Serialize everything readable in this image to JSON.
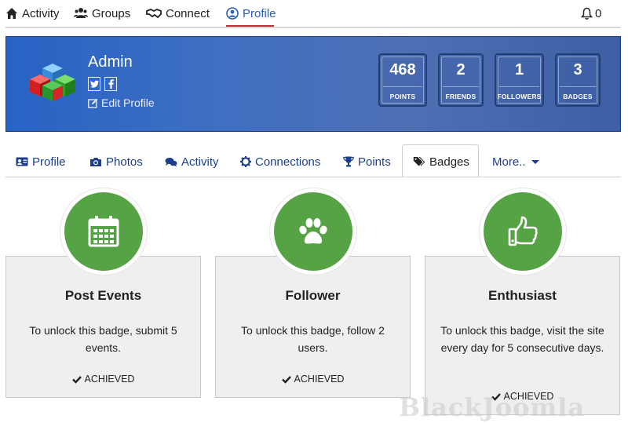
{
  "topnav": {
    "items": [
      {
        "label": "Activity",
        "icon": "home-icon"
      },
      {
        "label": "Groups",
        "icon": "users-icon"
      },
      {
        "label": "Connect",
        "icon": "handshake-icon"
      },
      {
        "label": "Profile",
        "icon": "user-circle-icon",
        "active": true
      }
    ],
    "notifications_count": "0"
  },
  "profile": {
    "name": "Admin",
    "edit_label": "Edit Profile",
    "social": [
      "twitter-icon",
      "facebook-icon"
    ],
    "stats": [
      {
        "value": "468",
        "label": "POINTS"
      },
      {
        "value": "2",
        "label": "FRIENDS"
      },
      {
        "value": "1",
        "label": "FOLLOWERS"
      },
      {
        "value": "3",
        "label": "BADGES"
      }
    ]
  },
  "tabs": [
    {
      "label": "Profile",
      "icon": "id-card-icon"
    },
    {
      "label": "Photos",
      "icon": "camera-icon"
    },
    {
      "label": "Activity",
      "icon": "comments-icon"
    },
    {
      "label": "Connections",
      "icon": "gear-icon"
    },
    {
      "label": "Points",
      "icon": "trophy-icon"
    },
    {
      "label": "Badges",
      "icon": "tags-icon",
      "active": true
    },
    {
      "label": "More..",
      "icon": "caret-down-icon"
    }
  ],
  "badges": [
    {
      "title": "Post Events",
      "description": "To unlock this badge, submit 5 events.",
      "status": "ACHIEVED",
      "icon": "calendar-icon"
    },
    {
      "title": "Follower",
      "description": "To unlock this badge, follow 2 users.",
      "status": "ACHIEVED",
      "icon": "paw-icon"
    },
    {
      "title": "Enthusiast",
      "description": "To unlock this badge, visit the site every day for 5 consecutive days.",
      "status": "ACHIEVED",
      "icon": "thumbs-up-icon"
    }
  ],
  "watermark": "BlackJoomla",
  "colors": {
    "accent": "#2a5bb5",
    "active_underline": "#b83434",
    "badge_green": "#56a346",
    "banner_blue": "#3f6fc2"
  }
}
